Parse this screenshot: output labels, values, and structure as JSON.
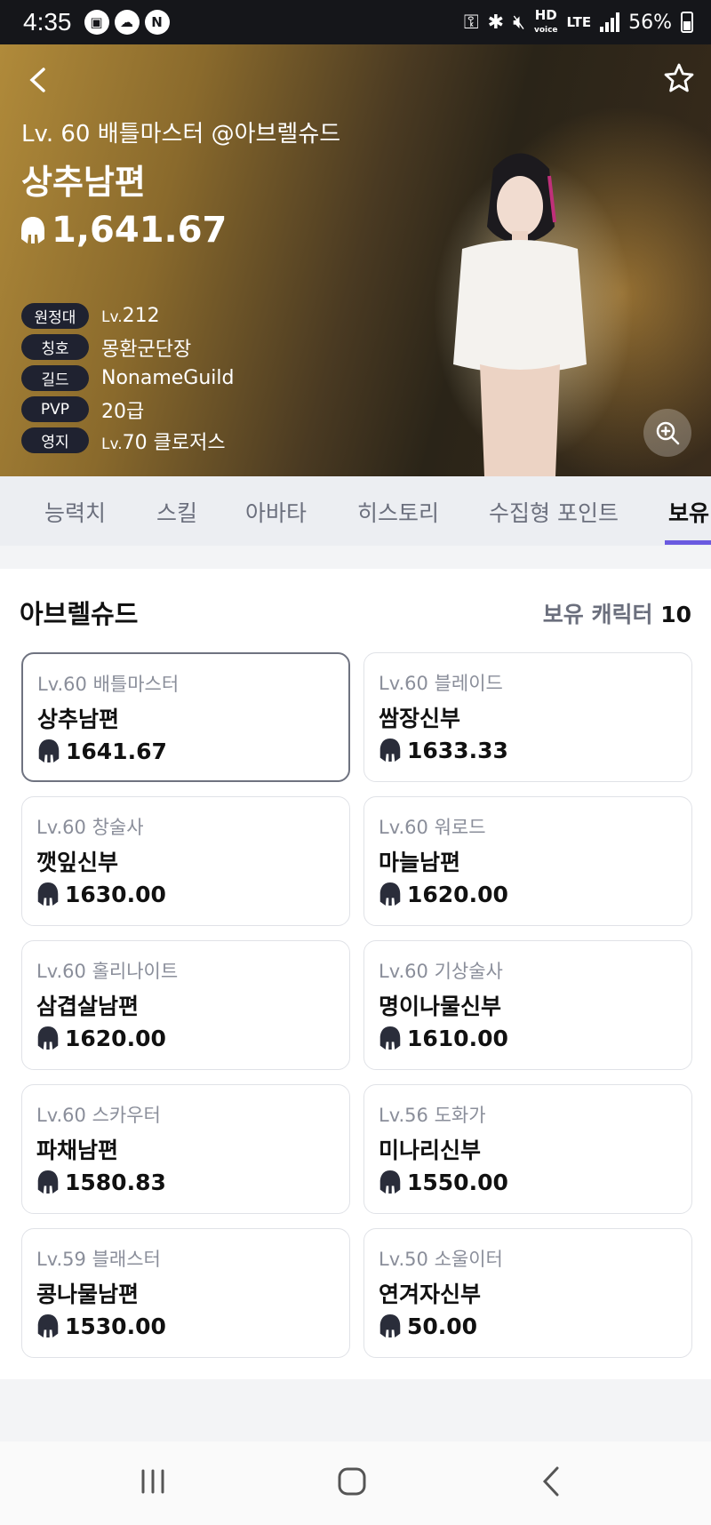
{
  "status_bar": {
    "time": "4:35",
    "left_icons": [
      "twitch-icon",
      "cloud-icon",
      "naver-icon"
    ],
    "hd_label": "HD",
    "voice_label": "voice",
    "lte_label": "LTE",
    "battery": "56%"
  },
  "hero": {
    "subtitle": "Lv. 60 배틀마스터 @아브렐슈드",
    "name": "상추남편",
    "item_level": "1,641.67",
    "info": [
      {
        "label": "원정대",
        "prefix": "Lv.",
        "value": "212"
      },
      {
        "label": "칭호",
        "prefix": "",
        "value": "몽환군단장"
      },
      {
        "label": "길드",
        "prefix": "",
        "value": "NonameGuild"
      },
      {
        "label": "PVP",
        "prefix": "",
        "value": "20급"
      },
      {
        "label": "영지",
        "prefix": "Lv.",
        "value": "70 클로저스"
      }
    ]
  },
  "tabs": [
    "능력치",
    "스킬",
    "아바타",
    "히스토리",
    "수집형 포인트",
    "보유"
  ],
  "active_tab": "보유",
  "roster": {
    "server": "아브렐슈드",
    "owned_label": "보유 캐릭터",
    "owned_count": "10",
    "characters": [
      {
        "cls": "Lv.60 배틀마스터",
        "name": "상추남편",
        "il": "1641.67",
        "selected": true
      },
      {
        "cls": "Lv.60 블레이드",
        "name": "쌈장신부",
        "il": "1633.33",
        "selected": false
      },
      {
        "cls": "Lv.60 창술사",
        "name": "깻잎신부",
        "il": "1630.00",
        "selected": false
      },
      {
        "cls": "Lv.60 워로드",
        "name": "마늘남편",
        "il": "1620.00",
        "selected": false
      },
      {
        "cls": "Lv.60 홀리나이트",
        "name": "삼겹살남편",
        "il": "1620.00",
        "selected": false
      },
      {
        "cls": "Lv.60 기상술사",
        "name": "명이나물신부",
        "il": "1610.00",
        "selected": false
      },
      {
        "cls": "Lv.60 스카우터",
        "name": "파채남편",
        "il": "1580.83",
        "selected": false
      },
      {
        "cls": "Lv.56 도화가",
        "name": "미나리신부",
        "il": "1550.00",
        "selected": false
      },
      {
        "cls": "Lv.59 블래스터",
        "name": "콩나물남편",
        "il": "1530.00",
        "selected": false
      },
      {
        "cls": "Lv.50 소울이터",
        "name": "연겨자신부",
        "il": "50.00",
        "selected": false
      }
    ]
  },
  "colors": {
    "accent": "#6a5ae0",
    "pill_bg": "#1f2230",
    "status_bar_bg": "#15161a"
  }
}
